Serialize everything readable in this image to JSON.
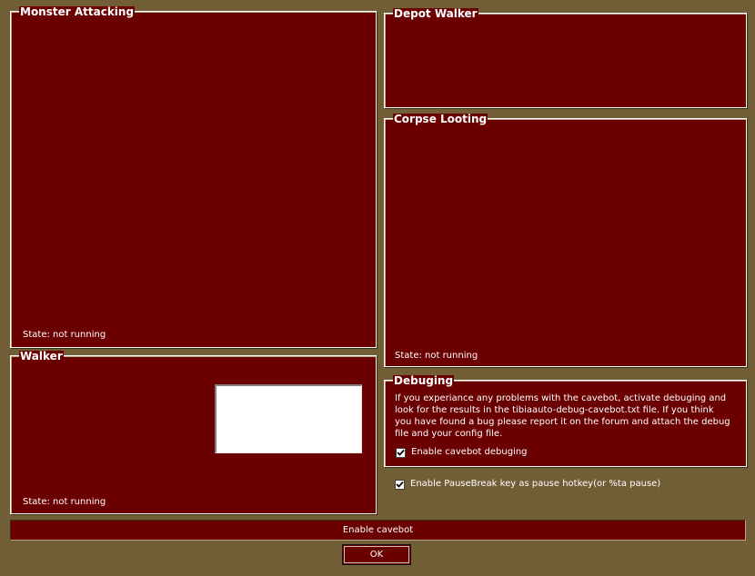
{
  "monster_attacking": {
    "title": "Monster Attacking",
    "state": "State: not running"
  },
  "depot_walker": {
    "title": "Depot Walker"
  },
  "corpse_looting": {
    "title": "Corpse Looting",
    "state": "State: not running"
  },
  "walker": {
    "title": "Walker",
    "state": "State: not running"
  },
  "debuging": {
    "title": "Debuging",
    "description": "If you experiance any problems with the cavebot, activate debuging and look for the results in the tibiaauto-debug-cavebot.txt file. If you think you have found a bug please report it on the forum and attach the debug file and your config file.",
    "checkbox_label": "Enable cavebot debuging",
    "checkbox_checked": true
  },
  "pause_hotkey": {
    "label": "Enable PauseBreak key as pause hotkey(or %ta pause)",
    "checked": true
  },
  "enable_cavebot_label": "Enable cavebot",
  "ok_label": "OK",
  "colors": {
    "background": "#725e36",
    "panel": "#6b0000",
    "text": "#ffffff"
  }
}
